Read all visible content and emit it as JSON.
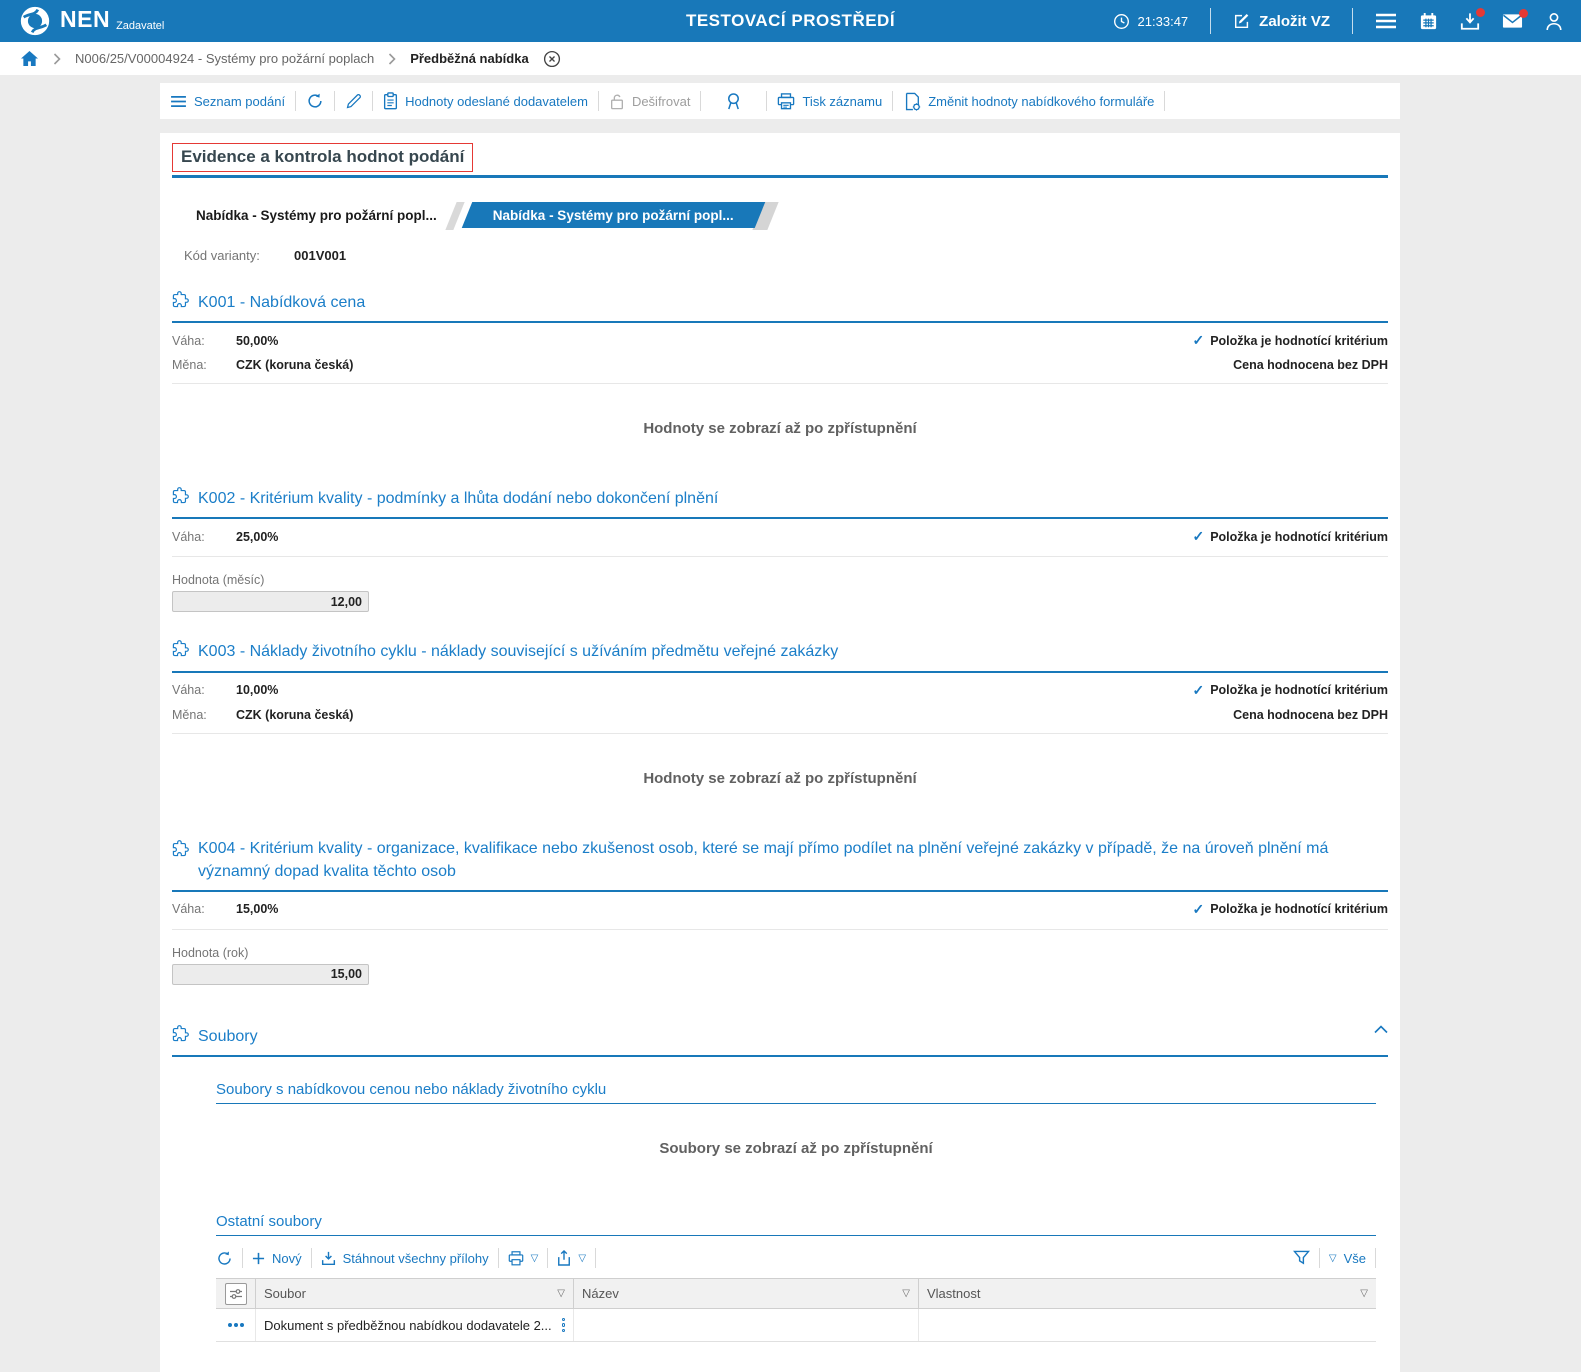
{
  "icons": {
    "check": "✓",
    "filter_caret": "▽"
  },
  "header": {
    "brand": "NEN",
    "brand_subtitle": "Zadavatel",
    "environment_title": "TESTOVACÍ PROSTŘEDÍ",
    "clock": "21:33:47",
    "create_vz_label": "Založit VZ"
  },
  "breadcrumb": {
    "items": [
      {
        "label": "N006/25/V00004924 - Systémy pro požární poplach"
      },
      {
        "label": "Předběžná nabídka"
      }
    ]
  },
  "toolbar": {
    "seznam_podani": "Seznam podání",
    "hodnoty_odeslane": "Hodnoty odeslané dodavatelem",
    "desifrovat": "Dešifrovat",
    "tisk_zaznamu": "Tisk záznamu",
    "zmenit_hodnoty": "Změnit hodnoty nabídkového formuláře"
  },
  "page": {
    "title": "Evidence a kontrola hodnot podání",
    "tabs": [
      {
        "label": "Nabídka - Systémy pro požární popl...",
        "active": false
      },
      {
        "label": "Nabídka - Systémy pro požární popl...",
        "active": true
      }
    ],
    "variant_code_label": "Kód varianty:",
    "variant_code": "001V001"
  },
  "criteria": [
    {
      "title": "K001 - Nabídková cena",
      "weight_label": "Váha:",
      "weight": "50,00%",
      "currency_label": "Měna:",
      "currency": "CZK (koruna česká)",
      "criterion_flag": "Položka je hodnotící kritérium",
      "vat_note": "Cena hodnocena bez DPH",
      "placeholder": "Hodnoty se zobrazí až po zpřístupnění"
    },
    {
      "title": "K002 - Kritérium kvality - podmínky a lhůta dodání nebo dokončení plnění",
      "weight_label": "Váha:",
      "weight": "25,00%",
      "criterion_flag": "Položka je hodnotící kritérium",
      "field_label": "Hodnota (měsíc)",
      "field_value": "12,00"
    },
    {
      "title": "K003 - Náklady životního cyklu - náklady související s užíváním předmětu veřejné zakázky",
      "weight_label": "Váha:",
      "weight": "10,00%",
      "currency_label": "Měna:",
      "currency": "CZK (koruna česká)",
      "criterion_flag": "Položka je hodnotící kritérium",
      "vat_note": "Cena hodnocena bez DPH",
      "placeholder": "Hodnoty se zobrazí až po zpřístupnění"
    },
    {
      "title": "K004 - Kritérium kvality - organizace, kvalifikace nebo zkušenost osob, které se mají přímo podílet na plnění veřejné zakázky v případě, že na úroveň plnění má významný dopad kvalita těchto osob",
      "weight_label": "Váha:",
      "weight": "15,00%",
      "criterion_flag": "Položka je hodnotící kritérium",
      "field_label": "Hodnota (rok)",
      "field_value": "15,00"
    }
  ],
  "files": {
    "title": "Soubory",
    "price_files": {
      "title": "Soubory s nabídkovou cenou nebo náklady životního cyklu",
      "placeholder": "Soubory se zobrazí až po zpřístupnění"
    },
    "other_files": {
      "title": "Ostatní soubory",
      "toolbar": {
        "new": "Nový",
        "download_all": "Stáhnout všechny přílohy",
        "all": "Vše"
      },
      "table": {
        "columns": [
          "Soubor",
          "Název",
          "Vlastnost"
        ],
        "rows": [
          {
            "soubor": "Dokument s předběžnou nabídkou dodavatele 2...",
            "nazev": "",
            "vlastnost": ""
          }
        ]
      }
    }
  }
}
